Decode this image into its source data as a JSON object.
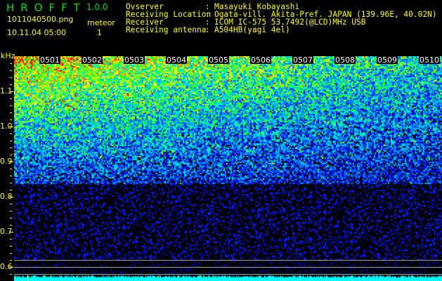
{
  "header": {
    "app_title": "HROFFT",
    "version": "1.0.0",
    "filename": "1011040500.png",
    "datetime": "10.11.04 05:00",
    "meteor_label": "meteor",
    "meteor_count": "1"
  },
  "info": [
    {
      "label": "Ovserver",
      "value": "Masayuki Kobayashi"
    },
    {
      "label": "Receiving Location",
      "value": "Ogata-vill. Akita-Pref. JAPAN (139.96E, 40.02N)"
    },
    {
      "label": "Receiver",
      "value": "ICOM IC-575 53.7492(@LCD)MHz USB"
    },
    {
      "label": "Receiving antenna",
      "value": "A504HB(yagi 4el)"
    }
  ],
  "spectrogram": {
    "y_unit": "kHz",
    "y_ticks": [
      "1.1",
      "1.0",
      "0.9",
      "0.8",
      "0.7",
      "0.6"
    ],
    "y_range_khz": [
      0.58,
      1.2
    ],
    "time_labels": [
      "0501",
      "0502",
      "0503",
      "0504",
      "0505",
      "0506",
      "0507",
      "0508",
      "0509",
      "0510"
    ],
    "colors": {
      "text": "#ffff00",
      "title": "#00e000",
      "signal_strip": "#00ffff",
      "reference_lines": "#a0a0a0"
    }
  }
}
